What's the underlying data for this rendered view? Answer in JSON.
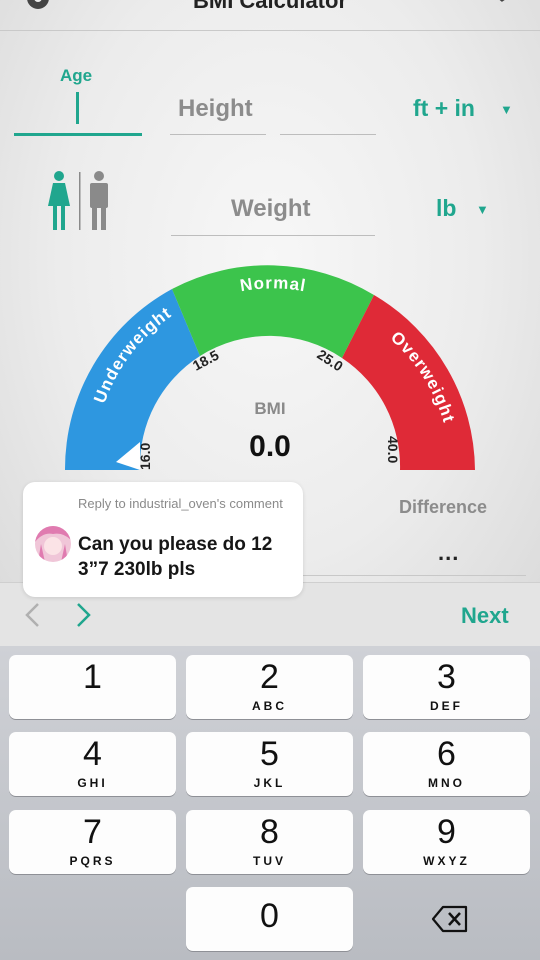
{
  "header": {
    "title": "BMI Calculator"
  },
  "form": {
    "age_label": "Age",
    "height_label": "Height",
    "height_unit": "ft + in",
    "weight_label": "Weight",
    "weight_unit": "lb"
  },
  "gauge": {
    "zones": [
      "Underweight",
      "Normal",
      "Overweight"
    ],
    "ticks": [
      "16.0",
      "18.5",
      "25.0",
      "40.0"
    ],
    "bmi_label": "BMI",
    "bmi_value": "0.0",
    "zone_colors": {
      "underweight": "#2e97e0",
      "normal": "#3cc44c",
      "overweight": "#df2a37"
    }
  },
  "difference": {
    "label": "Difference",
    "value": "..."
  },
  "nav": {
    "next_label": "Next"
  },
  "comment": {
    "reply_to": "Reply to industrial_oven's comment",
    "text": "Can you please do 12 3”7 230lb pls"
  },
  "keypad": {
    "keys": [
      {
        "num": "1",
        "letters": ""
      },
      {
        "num": "2",
        "letters": "ABC"
      },
      {
        "num": "3",
        "letters": "DEF"
      },
      {
        "num": "4",
        "letters": "GHI"
      },
      {
        "num": "5",
        "letters": "JKL"
      },
      {
        "num": "6",
        "letters": "MNO"
      },
      {
        "num": "7",
        "letters": "PQRS"
      },
      {
        "num": "8",
        "letters": "TUV"
      },
      {
        "num": "9",
        "letters": "WXYZ"
      },
      {
        "num": "0",
        "letters": ""
      }
    ]
  },
  "colors": {
    "accent": "#20a68e"
  },
  "icons": [
    "gear-icon",
    "share-icon",
    "female-icon",
    "male-icon",
    "prev-arrow-icon",
    "next-arrow-icon",
    "backspace-icon"
  ]
}
